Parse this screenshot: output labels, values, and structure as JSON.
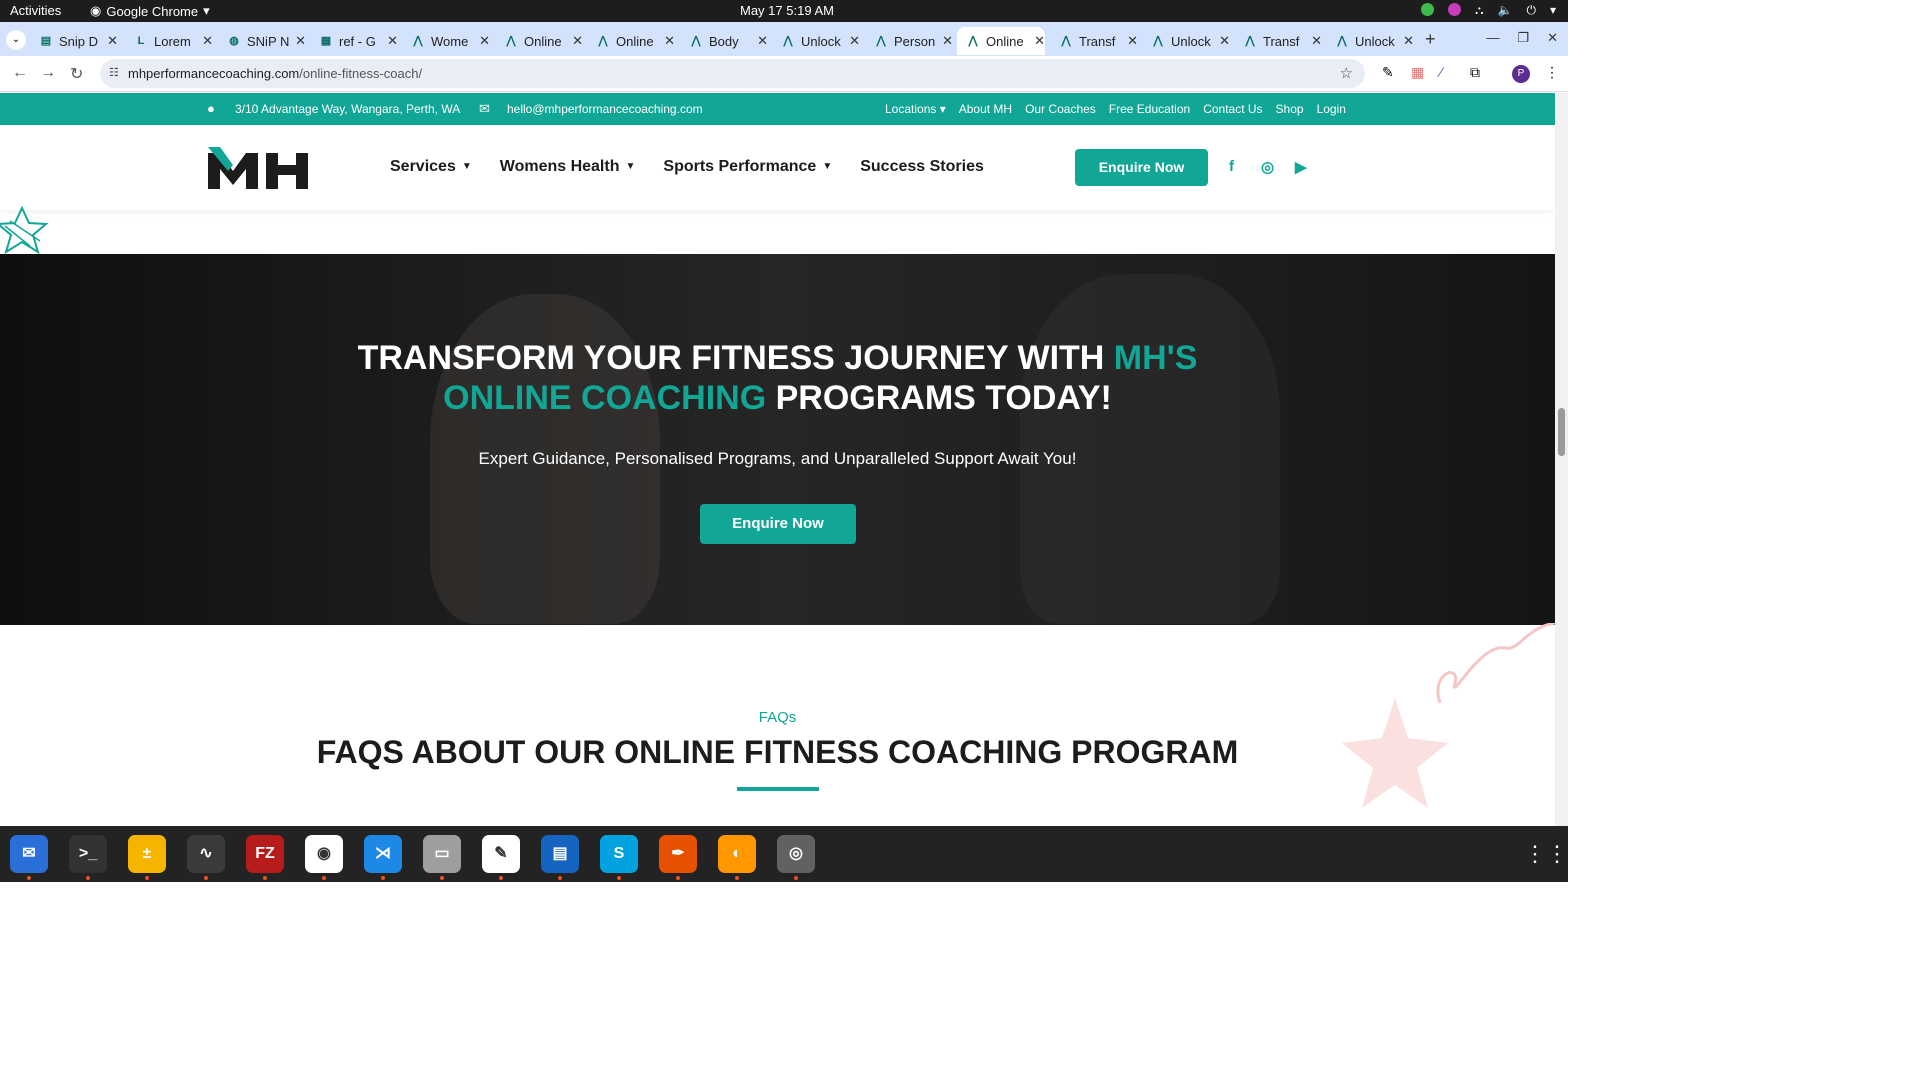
{
  "system_bar": {
    "activities": "Activities",
    "app_name": "Google Chrome",
    "clock": "May 17  5:19 AM"
  },
  "tabs": [
    {
      "label": "Snip D",
      "icon": "docs-icon"
    },
    {
      "label": "Lorem",
      "icon": "lorem-icon"
    },
    {
      "label": "SNiP N",
      "icon": "snip-icon"
    },
    {
      "label": "ref - G",
      "icon": "sheets-icon"
    },
    {
      "label": "Wome",
      "icon": "mh-icon"
    },
    {
      "label": "Online",
      "icon": "mh-icon"
    },
    {
      "label": "Online",
      "icon": "mh-icon"
    },
    {
      "label": "Body",
      "icon": "mh-icon"
    },
    {
      "label": "Unlock",
      "icon": "mh-icon"
    },
    {
      "label": "Person",
      "icon": "mh-icon"
    },
    {
      "label": "Online",
      "icon": "mh-icon",
      "active": true
    },
    {
      "label": "Transf",
      "icon": "mh-icon"
    },
    {
      "label": "Unlock",
      "icon": "mh-icon"
    },
    {
      "label": "Transf",
      "icon": "mh-icon"
    },
    {
      "label": "Unlock",
      "icon": "mh-icon"
    }
  ],
  "address_bar": {
    "domain": "mhperformancecoaching.com",
    "path": "/online-fitness-coach/"
  },
  "profile_initial": "P",
  "infobar": {
    "address": "3/10 Advantage Way, Wangara, Perth, WA",
    "email": "hello@mhperformancecoaching.com",
    "links": [
      "Locations",
      "About MH",
      "Our Coaches",
      "Free Education",
      "Contact Us",
      "Shop",
      "Login"
    ]
  },
  "header": {
    "logo_text": "MH",
    "nav": [
      {
        "label": "Services",
        "dropdown": true
      },
      {
        "label": "Womens Health",
        "dropdown": true
      },
      {
        "label": "Sports Performance",
        "dropdown": true
      },
      {
        "label": "Success Stories",
        "dropdown": false
      }
    ],
    "cta": "Enquire Now",
    "social": [
      "facebook-icon",
      "instagram-icon",
      "youtube-icon"
    ]
  },
  "hero": {
    "title_part1": "TRANSFORM YOUR FITNESS JOURNEY WITH ",
    "title_accent": "MH'S ONLINE COACHING",
    "title_part2": " PROGRAMS TODAY!",
    "subtitle": "Expert Guidance, Personalised Programs, and Unparalleled Support Await You!",
    "button": "Enquire Now"
  },
  "faq": {
    "label": "FAQs",
    "title": "FAQS ABOUT OUR ONLINE FITNESS COACHING PROGRAM"
  },
  "colors": {
    "brand_teal": "#11a695",
    "dark_text": "#1c1c1c"
  },
  "dock_apps": [
    "thunderbird-icon",
    "terminal-icon",
    "calculator-icon",
    "system-monitor-icon",
    "filezilla-icon",
    "chrome-icon",
    "vscode-icon",
    "files-icon",
    "text-editor-icon",
    "document-viewer-icon",
    "skype-icon",
    "inkscape-icon",
    "firefox-dev-icon",
    "disk-icon"
  ]
}
